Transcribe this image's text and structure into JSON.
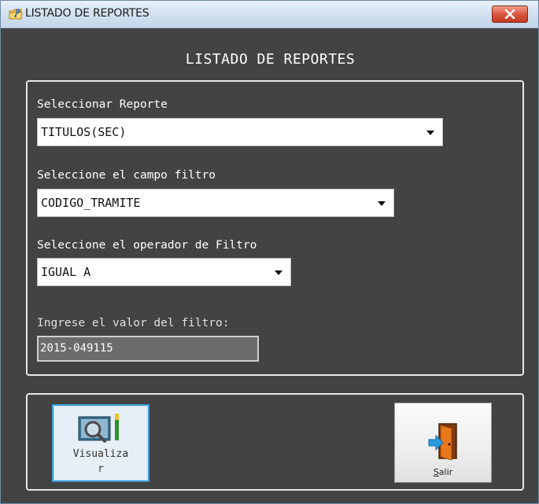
{
  "window": {
    "title": "LISTADO DE REPORTES"
  },
  "form": {
    "heading": "LISTADO DE REPORTES",
    "report": {
      "label": "Seleccionar Reporte",
      "value": "TITULOS(SEC)"
    },
    "filter_field": {
      "label": "Seleccione el campo filtro",
      "value": "CODIGO_TRAMITE"
    },
    "filter_operator": {
      "label": "Seleccione el operador de Filtro",
      "value": "IGUAL A"
    },
    "filter_value": {
      "label": "Ingrese el valor del filtro:",
      "value": "2015-049115"
    }
  },
  "buttons": {
    "visualizar": {
      "line1": "Visualiza",
      "line2": "r"
    },
    "salir": {
      "mnemonic": "S",
      "rest": "alir"
    }
  },
  "icons": {
    "app": "folder-key-icon",
    "close": "close-icon",
    "visualizar": "report-preview-magnifier-icon",
    "salir": "exit-door-icon"
  },
  "colors": {
    "window_bg": "#434343",
    "close_button": "#d9563e",
    "selected_button_border": "#3c9bd6",
    "text": "#ffffff"
  }
}
